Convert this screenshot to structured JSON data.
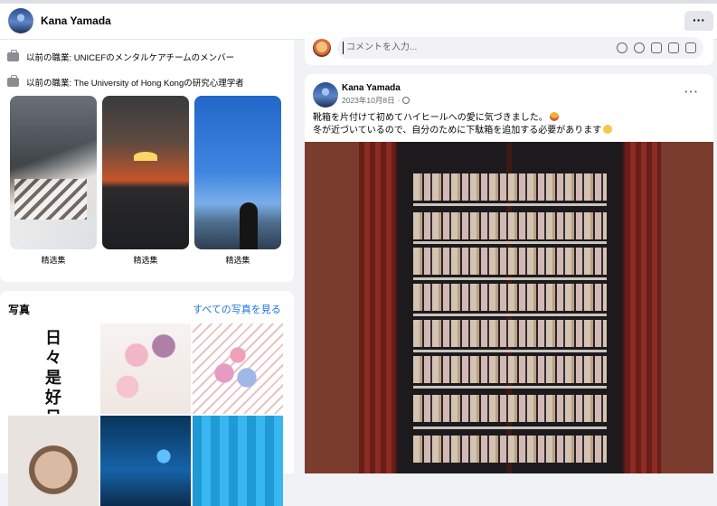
{
  "header": {
    "name": "Kana Yamada",
    "more_label": "···"
  },
  "intro": {
    "items": [
      {
        "icon": "briefcase-icon",
        "text": "以前の職業: UNICEFのメンタルケアチームのメンバー"
      },
      {
        "icon": "briefcase-icon",
        "text": "以前の職業: The University of Hong Kongの研究心理学者"
      }
    ],
    "featured": [
      {
        "label": "精选集"
      },
      {
        "label": "精选集"
      },
      {
        "label": "精选集"
      }
    ]
  },
  "photos": {
    "title": "写真",
    "see_all": "すべての写真を見る",
    "calligraphy": "日々是好日"
  },
  "comment": {
    "placeholder": "コメントを入力...",
    "icons": [
      "gif-avatar-icon",
      "emoji-icon",
      "camera-icon",
      "gif-icon",
      "sticker-icon"
    ]
  },
  "post": {
    "author": "Kana Yamada",
    "date": "2023年10月8日",
    "privacy_icon": "globe-icon",
    "more_label": "···",
    "line1": "靴箱を片付けて初めてハイヒールへの愛に気づきました。",
    "line2": "冬が近づいているので、自分のために下駄箱を追加する必要があります"
  }
}
